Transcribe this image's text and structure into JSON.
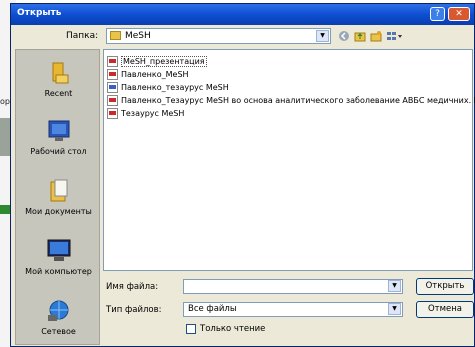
{
  "background": {
    "fragment_text": "ор"
  },
  "dialog": {
    "title": "Открыть",
    "help_button": "?",
    "close_button": "✕"
  },
  "lookin": {
    "label": "Папка:",
    "value": "МеSH",
    "dropdown_arrow": "▼"
  },
  "toolbar_icons": [
    "back-icon",
    "up-folder-icon",
    "new-folder-icon",
    "views-menu-icon"
  ],
  "places": [
    {
      "label": "Recent",
      "icon": "recent-icon"
    },
    {
      "label": "Рабочий стол",
      "icon": "desktop-icon"
    },
    {
      "label": "Мои документы",
      "icon": "documents-icon"
    },
    {
      "label": "Мой компьютер",
      "icon": "computer-icon"
    },
    {
      "label": "Сетевое",
      "icon": "network-icon"
    }
  ],
  "files": [
    {
      "name": "МеSH_презентация",
      "selected": true
    },
    {
      "name": "Павленко_МеSH"
    },
    {
      "name": "Павленко_тезаурус МеSH"
    },
    {
      "name": "Павленко_Тезаурус МеSH во основа аналитического заболевание АВБС медичних. Б"
    },
    {
      "name": "Тезаурус МеSH"
    }
  ],
  "filename": {
    "label": "Имя файла:",
    "value": ""
  },
  "filetype": {
    "label": "Тип файлов:",
    "value": "Все файлы"
  },
  "buttons": {
    "open": "Открыть",
    "cancel": "Отмена"
  },
  "readonly_label": "Только чтение"
}
